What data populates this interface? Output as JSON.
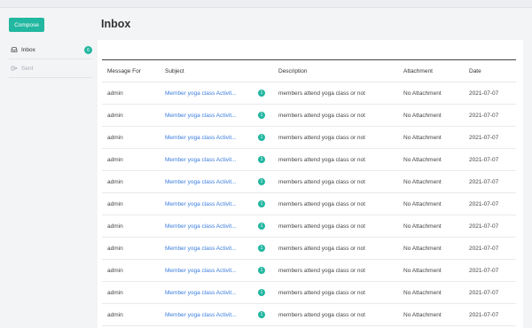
{
  "sidebar": {
    "compose_label": "Compose",
    "items": [
      {
        "label": "Inbox",
        "badge": "6",
        "icon": "inbox-icon"
      },
      {
        "label": "Sent",
        "icon": "send-icon"
      }
    ]
  },
  "page": {
    "title": "Inbox"
  },
  "table": {
    "headers": [
      "Message For",
      "Subject",
      "",
      "Description",
      "Attachment",
      "Date"
    ],
    "rows": [
      {
        "for": "admin",
        "subject": "Member yoga class Activit...",
        "badge": "1",
        "description": "members attend yoga class or not",
        "attachment": "No Attachment",
        "date": "2021-07-07"
      },
      {
        "for": "admin",
        "subject": "Member yoga class Activit...",
        "badge": "1",
        "description": "members attend yoga class or not",
        "attachment": "No Attachment",
        "date": "2021-07-07"
      },
      {
        "for": "admin",
        "subject": "Member yoga class Activit...",
        "badge": "1",
        "description": "members attend yoga class or not",
        "attachment": "No Attachment",
        "date": "2021-07-07"
      },
      {
        "for": "admin",
        "subject": "Member yoga class Activit...",
        "badge": "1",
        "description": "members attend yoga class or not",
        "attachment": "No Attachment",
        "date": "2021-07-07"
      },
      {
        "for": "admin",
        "subject": "Member yoga class Activit...",
        "badge": "1",
        "description": "members attend yoga class or not",
        "attachment": "No Attachment",
        "date": "2021-07-07"
      },
      {
        "for": "admin",
        "subject": "Member yoga class Activit...",
        "badge": "1",
        "description": "members attend yoga class or not",
        "attachment": "No Attachment",
        "date": "2021-07-07"
      },
      {
        "for": "admin",
        "subject": "Member yoga class Activit...",
        "badge": "1",
        "description": "members attend yoga class or not",
        "attachment": "No Attachment",
        "date": "2021-07-07"
      },
      {
        "for": "admin",
        "subject": "Member yoga class Activit...",
        "badge": "1",
        "description": "members attend yoga class or not",
        "attachment": "No Attachment",
        "date": "2021-07-07"
      },
      {
        "for": "admin",
        "subject": "Member yoga class Activit...",
        "badge": "1",
        "description": "members attend yoga class or not",
        "attachment": "No Attachment",
        "date": "2021-07-07"
      },
      {
        "for": "admin",
        "subject": "Member yoga class Activit...",
        "badge": "1",
        "description": "members attend yoga class or not",
        "attachment": "No Attachment",
        "date": "2021-07-07"
      },
      {
        "for": "admin",
        "subject": "Member yoga class Activit...",
        "badge": "1",
        "description": "members attend yoga class or not",
        "attachment": "No Attachment",
        "date": "2021-07-07"
      }
    ]
  },
  "colors": {
    "accent": "#22b7a0",
    "link": "#3b7ddd"
  }
}
